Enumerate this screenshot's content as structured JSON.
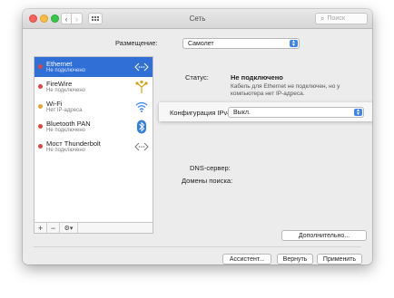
{
  "window": {
    "title": "Сеть",
    "search_placeholder": "Поиск",
    "search_icon": "magnifier-icon"
  },
  "location": {
    "label": "Размещение:",
    "value": "Самолет"
  },
  "services": [
    {
      "name": "Ethernet",
      "status": "Не подключено",
      "dot_color": "#e0443e",
      "icon": "ethernet-icon",
      "selected": true
    },
    {
      "name": "FireWire",
      "status": "Не подключено",
      "dot_color": "#e0443e",
      "icon": "firewire-icon",
      "selected": false
    },
    {
      "name": "Wi-Fi",
      "status": "Нет IP-адреса",
      "dot_color": "#e7a52d",
      "icon": "wifi-icon",
      "selected": false
    },
    {
      "name": "Bluetooth PAN",
      "status": "Не подключено",
      "dot_color": "#e0443e",
      "icon": "bluetooth-icon",
      "selected": false
    },
    {
      "name": "Мост Thunderbolt",
      "status": "Не подключено",
      "dot_color": "#e0443e",
      "icon": "thunderbolt-bridge-icon",
      "selected": false
    }
  ],
  "sidebar_toolbar": {
    "add": "+",
    "remove": "−",
    "actions": "⚙▾"
  },
  "detail": {
    "status_label": "Статус:",
    "status_value": "Не подключено",
    "status_desc_line1": "Кабель для Ethernet не подключен, но у",
    "status_desc_line2": "компьютера нет IP-адреса.",
    "ipv4_label": "Конфигурация IPv4:",
    "ipv4_value": "Выкл.",
    "dns_label": "DNS-сервер:",
    "search_domains_label": "Домены поиска:",
    "advanced_button": "Дополнительно...",
    "help_button": "?"
  },
  "footer": {
    "assistant_button": "Ассистент...",
    "revert_button": "Вернуть",
    "apply_button": "Применить"
  },
  "colors": {
    "accent": "#3c84f4",
    "selection": "#2f6fd6",
    "disconnected": "#e0443e",
    "no_ip": "#e7a52d"
  }
}
